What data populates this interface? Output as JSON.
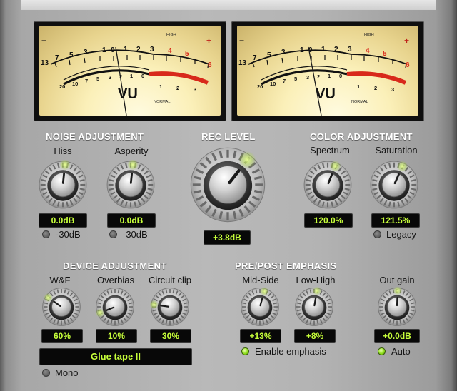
{
  "meters": {
    "left": {
      "scale_top": [
        "13",
        "7",
        "5",
        "3",
        "1",
        "0",
        "1",
        "2",
        "3",
        "4",
        "5",
        "6"
      ],
      "scale_bottom": [
        "20",
        "10",
        "7",
        "5",
        "3",
        "2",
        "1",
        "0",
        "1",
        "2",
        "3"
      ],
      "minus": "−",
      "plus": "+",
      "high": "HIGH",
      "normal": "NORMAL",
      "vu": "VU"
    },
    "right": {
      "scale_top": [
        "13",
        "7",
        "5",
        "3",
        "1",
        "0",
        "1",
        "2",
        "3",
        "4",
        "5",
        "6"
      ],
      "scale_bottom": [
        "20",
        "10",
        "7",
        "5",
        "3",
        "2",
        "1",
        "0",
        "1",
        "2",
        "3"
      ],
      "minus": "−",
      "plus": "+",
      "high": "HIGH",
      "normal": "NORMAL",
      "vu": "VU"
    }
  },
  "noise": {
    "title": "NOISE ADJUSTMENT",
    "hiss": {
      "label": "Hiss",
      "value": "0.0dB"
    },
    "asperity": {
      "label": "Asperity",
      "value": "0.0dB"
    },
    "hiss_toggle": "-30dB",
    "asperity_toggle": "-30dB"
  },
  "rec": {
    "title": "REC LEVEL",
    "value": "+3.8dB"
  },
  "color": {
    "title": "COLOR ADJUSTMENT",
    "spectrum": {
      "label": "Spectrum",
      "value": "120.0%"
    },
    "saturation": {
      "label": "Saturation",
      "value": "121.5%"
    },
    "legacy": "Legacy"
  },
  "device": {
    "title": "DEVICE ADJUSTMENT",
    "wf": {
      "label": "W&F",
      "value": "60%"
    },
    "overbias": {
      "label": "Overbias",
      "value": "10%"
    },
    "clip": {
      "label": "Circuit clip",
      "value": "30%"
    },
    "preset": "Glue tape II",
    "mono": "Mono"
  },
  "emphasis": {
    "title": "PRE/POST EMPHASIS",
    "midside": {
      "label": "Mid-Side",
      "value": "+13%"
    },
    "lowhigh": {
      "label": "Low-High",
      "value": "+8%"
    },
    "enable": "Enable emphasis"
  },
  "out": {
    "label": "Out gain",
    "value": "+0.0dB",
    "auto": "Auto"
  },
  "colors": {
    "lcd_text": "#c7ff3a",
    "led_on": "#8fdf1c",
    "meter_red": "#d8291b",
    "panel": "#b5b5b5"
  }
}
